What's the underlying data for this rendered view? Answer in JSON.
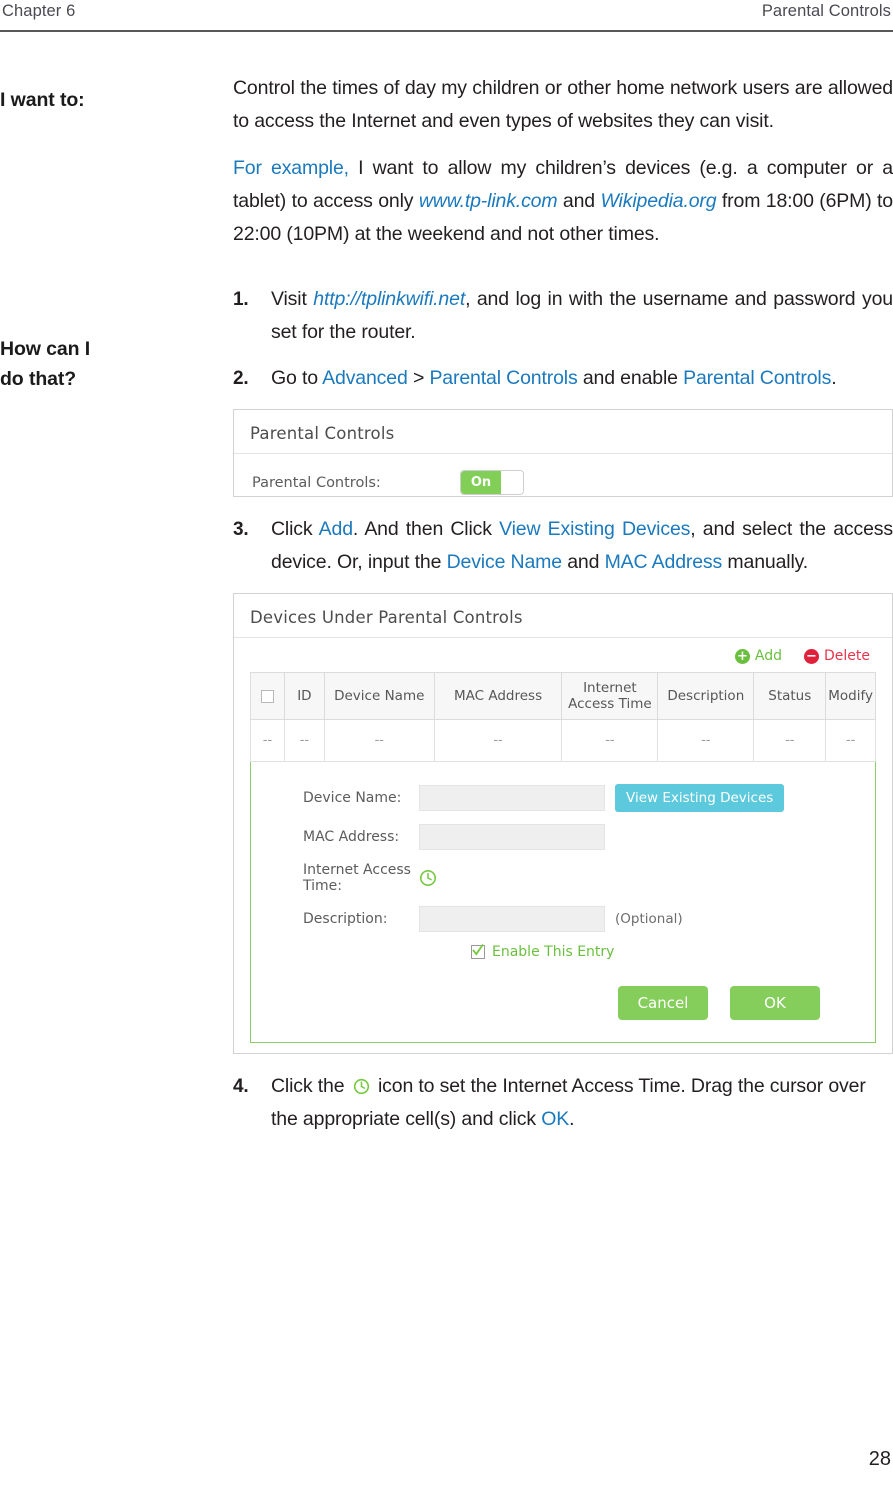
{
  "header": {
    "chapter": "Chapter 6",
    "section": "Parental Controls"
  },
  "sidebar": {
    "label_want": "I want to:",
    "label_how_line1": "How can I",
    "label_how_line2": "do that?"
  },
  "intro": {
    "paragraph1": "Control the times of day my children or other home network users are allowed to access the Internet and even types of websites they can visit.",
    "example_lead": "For example,",
    "example_rest1": " I want to allow my children’s devices (e.g. a computer or a tablet) to access only ",
    "example_link1": "www.tp-link.com",
    "example_mid": " and ",
    "example_link2": "Wikipedia.org",
    "example_rest2": " from 18:00 (6PM) to 22:00 (10PM) at the weekend and not other times."
  },
  "steps": {
    "step1_pre": "Visit ",
    "step1_link": "http://tplinkwifi.net",
    "step1_post": ", and log in with the username and password you set for the router.",
    "step2_pre": "Go to ",
    "step2_link1": "Advanced",
    "step2_gt": " > ",
    "step2_link2": "Parental Controls",
    "step2_mid": " and enable ",
    "step2_link3": "Parental Controls",
    "step2_post": ".",
    "step3_pre": "Click ",
    "step3_link1": "Add",
    "step3_mid1": ". And then Click ",
    "step3_link2": "View Existing Devices",
    "step3_mid2": ", and select the access device. Or, input the ",
    "step3_link3": "Device Name",
    "step3_mid3": " and ",
    "step3_link4": "MAC Address",
    "step3_post": " manually.",
    "step4_pre": "Click the ",
    "step4_mid": " icon to set the Internet Access Time. Drag the cursor over the appropriate cell(s) and click ",
    "step4_link": "OK",
    "step4_post": "."
  },
  "parental_controls_panel": {
    "title": "Parental Controls",
    "row_label": "Parental Controls:",
    "toggle_state": "On"
  },
  "devices_panel": {
    "title": "Devices Under Parental Controls",
    "add_label": "Add",
    "delete_label": "Delete",
    "add_icon": "plus-circle-icon",
    "delete_icon": "minus-circle-icon",
    "columns": [
      "",
      "ID",
      "Device Name",
      "MAC Address",
      "Internet Access Time",
      "Description",
      "Status",
      "Modify"
    ],
    "rows": [
      [
        "--",
        "--",
        "--",
        "--",
        "--",
        "--",
        "--",
        "--"
      ]
    ],
    "form": {
      "device_name_label": "Device Name:",
      "device_name_value": "",
      "mac_address_label": "MAC Address:",
      "mac_address_value": "",
      "internet_access_time_label": "Internet Access Time:",
      "internet_access_time_icon": "clock-icon",
      "description_label": "Description:",
      "description_value": "",
      "description_hint": "(Optional)",
      "view_existing_devices_label": "View Existing Devices",
      "enable_entry_label": "Enable This Entry",
      "enable_entry_checked": true,
      "cancel_label": "Cancel",
      "ok_label": "OK"
    }
  },
  "footer": {
    "page_number": "28"
  },
  "colors": {
    "link_blue": "#1b79be",
    "green": "#81cf56",
    "button_green": "#85ce5b",
    "cyan": "#5cc9dd",
    "red": "#e0213c",
    "add_green": "#6abf3f"
  }
}
